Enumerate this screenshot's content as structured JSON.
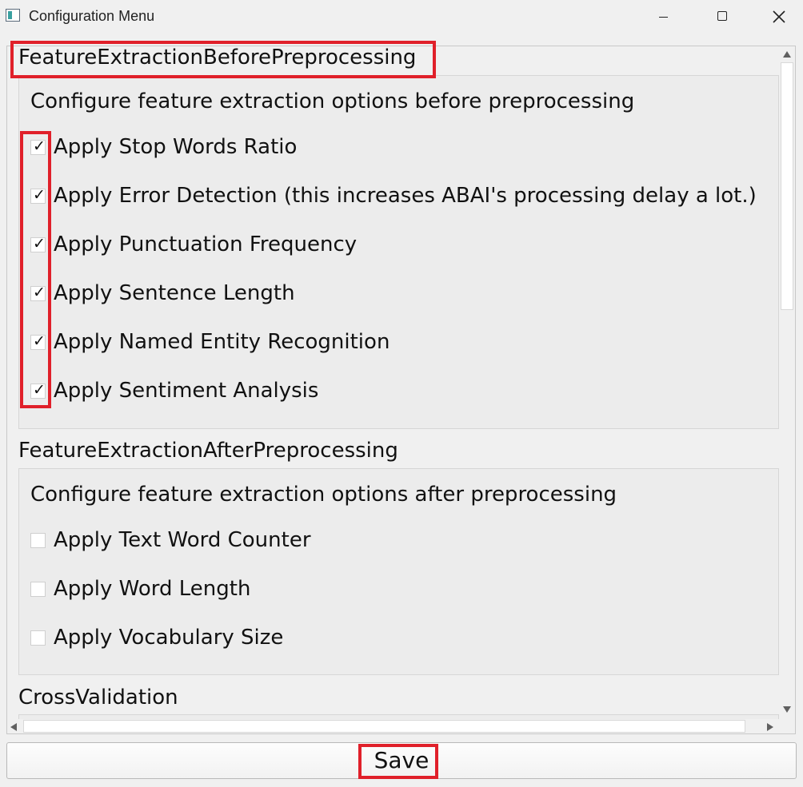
{
  "window": {
    "title": "Configuration Menu",
    "icon": "app-window-icon",
    "controls": [
      "minimize-icon",
      "maximize-icon",
      "close-icon"
    ]
  },
  "sections": [
    {
      "title": "FeatureExtractionBeforePreprocessing",
      "description": "Configure feature extraction options before preprocessing",
      "options": [
        {
          "label": "Apply Stop Words Ratio",
          "checked": true
        },
        {
          "label": "Apply Error Detection (this increases ABAI's processing delay a lot.)",
          "checked": true
        },
        {
          "label": "Apply Punctuation Frequency",
          "checked": true
        },
        {
          "label": "Apply Sentence Length",
          "checked": true
        },
        {
          "label": "Apply Named Entity Recognition",
          "checked": true
        },
        {
          "label": "Apply Sentiment Analysis",
          "checked": true
        }
      ]
    },
    {
      "title": "FeatureExtractionAfterPreprocessing",
      "description": "Configure feature extraction options after preprocessing",
      "options": [
        {
          "label": "Apply Text Word Counter",
          "checked": false
        },
        {
          "label": "Apply Word Length",
          "checked": false
        },
        {
          "label": "Apply Vocabulary Size",
          "checked": false
        }
      ]
    },
    {
      "title": "CrossValidation"
    }
  ],
  "save_button": {
    "label": "Save"
  },
  "colors": {
    "highlight": "#e0202a",
    "background": "#f0f0f0",
    "group_background": "#ececec"
  }
}
